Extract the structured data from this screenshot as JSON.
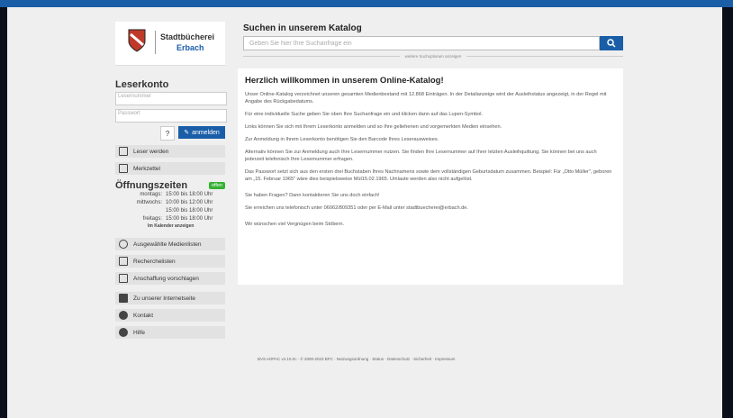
{
  "logo": {
    "line1": "Stadtbücherei",
    "line2": "Erbach"
  },
  "account": {
    "title": "Leserkonto",
    "username_placeholder": "Lesernummer",
    "password_placeholder": "Passwort",
    "help": "?",
    "login_label": "anmelden"
  },
  "links1": [
    {
      "label": "Leser werden"
    },
    {
      "label": "Merkzettel"
    }
  ],
  "opening": {
    "title": "Öffnungszeiten",
    "badge": "offen",
    "rows": [
      {
        "day": "montags:",
        "time": "15:00 bis 18:00 Uhr"
      },
      {
        "day": "mittwochs:",
        "time": "10:00 bis 12:00 Uhr"
      },
      {
        "day": "",
        "time": "15:00 bis 18:00 Uhr"
      },
      {
        "day": "freitags:",
        "time": "15:00 bis 18:00 Uhr"
      }
    ],
    "calendar": "Im Kalender anzeigen"
  },
  "links2": [
    {
      "label": "Ausgewählte Medienlisten"
    },
    {
      "label": "Recherchelisten"
    },
    {
      "label": "Anschaffung vorschlagen"
    }
  ],
  "links3": [
    {
      "label": "Zu unserer Internetseite"
    },
    {
      "label": "Kontakt"
    },
    {
      "label": "Hilfe"
    }
  ],
  "search": {
    "title": "Suchen in unserem Katalog",
    "placeholder": "Geben Sie hier Ihre Suchanfrage ein",
    "more": "weitere Suchoptionen anzeigen"
  },
  "content": {
    "heading": "Herzlich willkommen in unserem Online-Katalog!",
    "paragraphs": [
      "Unser Online-Katalog verzeichnet unseren gesamten Medienbestand mit 12.868 Einträgen. In der Detailanzeige wird der Ausleihstatus angezeigt, in der Regel mit Angabe des Rückgabedatums.",
      "Für eine individuelle Suche geben Sie oben Ihre Suchanfrage ein und klicken dann auf das Lupen-Symbol.",
      "Links können Sie sich mit Ihrem Leserkonto anmelden und so Ihre geliehenen und vorgemerkten Medien einsehen.",
      "Zur Anmeldung in Ihrem Leserkonto benötigen Sie den Barcode Ihres Leserausweises.",
      "Alternativ können Sie zur Anmeldung auch Ihre Lesernummer nutzen. Sie finden Ihre Lesernummer auf Ihrer letzten Ausleihquittung. Sie können bei uns auch jederzeit telefonisch Ihre Lesernummer erfragen.",
      "Das Passwort setzt sich aus den ersten drei Buchstaben Ihres Nachnamens sowie dem vollständigen Geburtsdatum zusammen. Beispiel: Für „Otto Müller\", geboren am „15. Februar 1965\" wäre dies beispielsweise Mül15.02.1965. Umlaute werden also nicht aufgelöst.",
      "Sie haben Fragen? Dann kontaktieren Sie uns doch einfach!",
      "Sie erreichen uns telefonisch unter 06062/809351 oder per E-Mail unter stadtbuecherei@erbach.de.",
      "Wir wünschen viel Vergnügen beim Stöbern."
    ]
  },
  "footer": "BVS eOPAC v4.10.0c · © 2000-2023 BFC · Nutzungsordnung · Status · Datenschutz · Sicherheit · Impressum"
}
